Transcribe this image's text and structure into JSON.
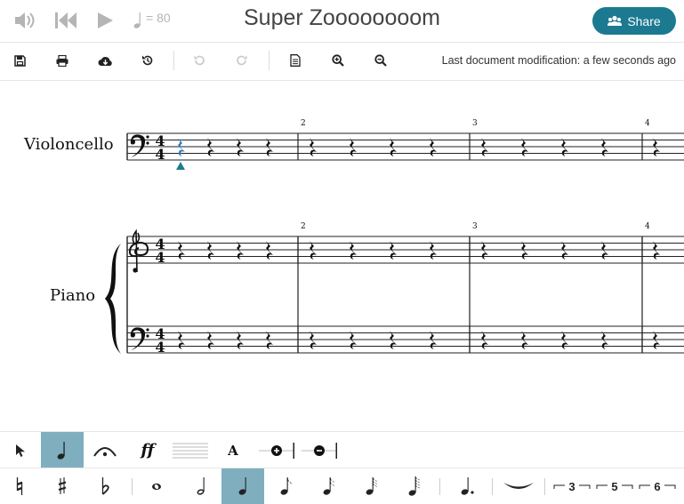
{
  "header": {
    "title": "Super Zoooooooom",
    "tempo": "= 80",
    "share_label": "Share",
    "icons": [
      "volume-icon",
      "skip-back-icon",
      "play-icon",
      "quarter-note-icon",
      "users-icon"
    ]
  },
  "toolbar": {
    "items": [
      "save-icon",
      "print-icon",
      "cloud-download-icon",
      "history-icon",
      "undo-icon",
      "redo-icon",
      "document-icon",
      "zoom-in-icon",
      "zoom-out-icon"
    ],
    "last_modification": "Last document modification: a few seconds ago"
  },
  "score": {
    "instruments": [
      {
        "name": "Violoncello",
        "staves": 1,
        "clefs": [
          "bass"
        ]
      },
      {
        "name": "Piano",
        "staves": 2,
        "clefs": [
          "treble",
          "bass"
        ]
      }
    ],
    "time_signature": {
      "numerator": "4",
      "denominator": "4"
    },
    "measure_numbers": [
      "2",
      "3",
      "4"
    ],
    "selected_measure": 1
  },
  "palette": {
    "tools": [
      "pointer-icon",
      "note-tool-icon",
      "fermata-icon",
      "dynamics-icon",
      "staff-lines-icon",
      "text-tool-icon",
      "add-staff-icon",
      "remove-staff-icon"
    ],
    "dynamics_label": "ff",
    "text_label": "A",
    "active_tool": "note-tool",
    "durations": [
      "natural-icon",
      "sharp-icon",
      "flat-icon",
      "whole-note-icon",
      "half-note-icon",
      "quarter-note-icon",
      "eighth-note-icon",
      "sixteenth-note-icon",
      "thirty-second-note-icon",
      "sixty-fourth-note-icon",
      "dotted-note-icon",
      "tie-icon"
    ],
    "tuplets": [
      "3",
      "5",
      "6"
    ],
    "active_duration": "quarter-note",
    "accent_color": "#7fafbe",
    "share_color": "#1b7a90"
  }
}
